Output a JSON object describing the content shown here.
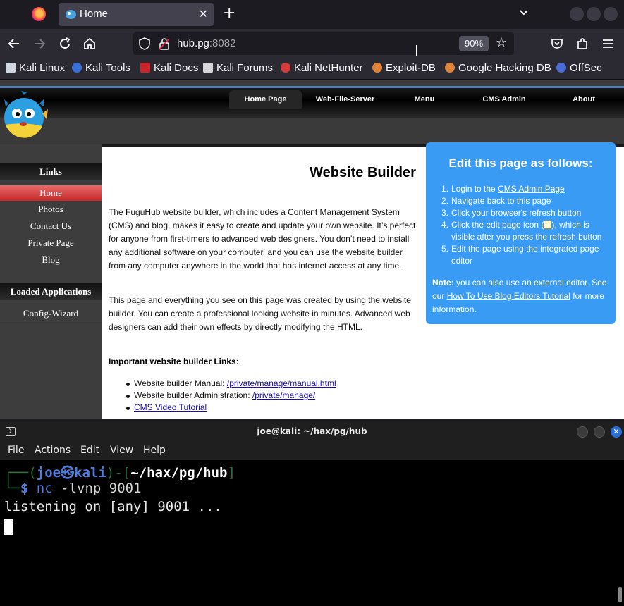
{
  "browser": {
    "tab": {
      "title": "Home"
    },
    "url": {
      "host": "hub.pg",
      "port": ":8082"
    },
    "zoom": "90%",
    "bookmarks": [
      {
        "label": "Kali Linux",
        "icon": "kali-dragon-icon"
      },
      {
        "label": "Kali Tools",
        "icon": "kali-tools-icon"
      },
      {
        "label": "Kali Docs",
        "icon": "kali-docs-icon"
      },
      {
        "label": "Kali Forums",
        "icon": "kali-forums-icon"
      },
      {
        "label": "Kali NetHunter",
        "icon": "nethunter-icon"
      },
      {
        "label": "Exploit-DB",
        "icon": "exploitdb-icon"
      },
      {
        "label": "Google Hacking DB",
        "icon": "ghdb-icon"
      },
      {
        "label": "OffSec",
        "icon": "offsec-icon"
      }
    ]
  },
  "site": {
    "topnav": [
      "Home Page",
      "Web-File-Server",
      "Menu",
      "CMS Admin",
      "About"
    ],
    "sidebar": {
      "links_heading": "Links",
      "links": [
        "Home",
        "Photos",
        "Contact Us",
        "Private Page",
        "Blog"
      ],
      "apps_heading": "Loaded Applications",
      "apps": [
        "Config-Wizard"
      ]
    },
    "content": {
      "title": "Website Builder",
      "para1": "The FuguHub website builder, which includes a Content Management System (CMS) and blog, makes it easy to create and update your own website. It’s perfect for anyone from first-timers to advanced web designers. You don’t need to install any additional software on your computer, and you can use the website builder from any computer anywhere in the world that has internet access at any time.",
      "para2": "This page and everything you see on this page was created by using the website builder. You can create a professional looking website in minutes. Advanced web designers can add their own effects by directly modifying the HTML.",
      "links_heading": "Important website builder Links:",
      "links": [
        {
          "prefix": "Website builder Manual: ",
          "link": "/private/manage/manual.html"
        },
        {
          "prefix": "Website builder Administration: ",
          "link": "/private/manage/"
        },
        {
          "prefix": "",
          "link": "CMS Video Tutorial"
        }
      ]
    },
    "editbox": {
      "title": "Edit this page as follows:",
      "step1_pre": "Login to the ",
      "step1_link": "CMS Admin Page",
      "step2": "Navigate back to this page",
      "step3": "Click your browser's refresh button",
      "step4_pre": "Click the edit page icon (",
      "step4_post": "), which is visible after you press the refresh button",
      "step5": "Edit the page using the integrated page editor",
      "note_label": "Note:",
      "note_pre": " you can also use an external editor. See our ",
      "note_link": "How To Use Blog Editors Tutorial",
      "note_post": " for more information."
    },
    "colors": {
      "accent_blue": "#3a9bf5",
      "home_red": "#d83a3a"
    }
  },
  "terminal": {
    "title": "joe@kali: ~/hax/pg/hub",
    "menu": [
      "File",
      "Actions",
      "Edit",
      "View",
      "Help"
    ],
    "user": "joe",
    "host": "kali",
    "cwd": "~/hax/pg/hub",
    "cmd": "nc",
    "args": "-lvnp 9001",
    "output": "listening on [any] 9001 ..."
  }
}
